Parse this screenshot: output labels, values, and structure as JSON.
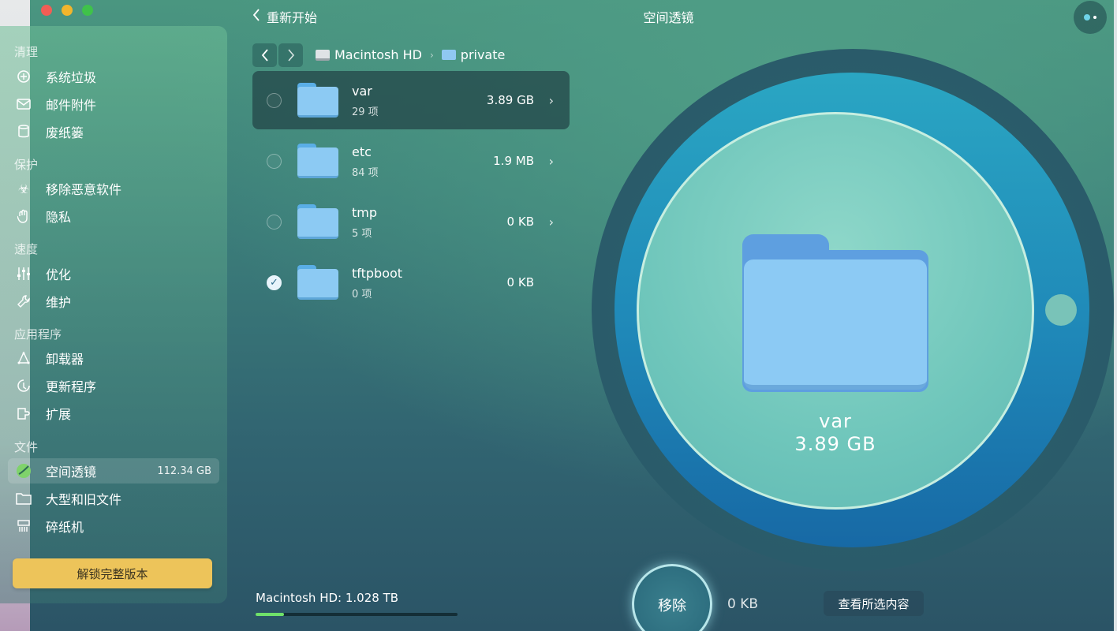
{
  "window": {
    "restart_label": "重新开始",
    "title": "空间透镜"
  },
  "sidebar": {
    "sections": [
      {
        "label": "清理",
        "items": [
          {
            "label": "系统垃圾",
            "icon": "trash-disc-icon"
          },
          {
            "label": "邮件附件",
            "icon": "envelope-icon"
          },
          {
            "label": "废纸篓",
            "icon": "bin-icon"
          }
        ]
      },
      {
        "label": "保护",
        "items": [
          {
            "label": "移除恶意软件",
            "icon": "biohazard-icon"
          },
          {
            "label": "隐私",
            "icon": "hand-icon"
          }
        ]
      },
      {
        "label": "速度",
        "items": [
          {
            "label": "优化",
            "icon": "sliders-icon"
          },
          {
            "label": "维护",
            "icon": "wrench-icon"
          }
        ]
      },
      {
        "label": "应用程序",
        "items": [
          {
            "label": "卸载器",
            "icon": "uninstaller-icon"
          },
          {
            "label": "更新程序",
            "icon": "update-icon"
          },
          {
            "label": "扩展",
            "icon": "extension-icon"
          }
        ]
      },
      {
        "label": "文件",
        "items": [
          {
            "label": "空间透镜",
            "icon": "space-lens-icon",
            "count": "112.34 GB",
            "active": true
          },
          {
            "label": "大型和旧文件",
            "icon": "folder-icon"
          },
          {
            "label": "碎纸机",
            "icon": "shredder-icon"
          }
        ]
      }
    ],
    "unlock_label": "解锁完整版本"
  },
  "breadcrumb": {
    "drive": "Macintosh HD",
    "folder": "private"
  },
  "files": [
    {
      "name": "var",
      "count": "29 项",
      "size": "3.89 GB",
      "selected": true,
      "checked": false,
      "chevron": true
    },
    {
      "name": "etc",
      "count": "84 项",
      "size": "1.9 MB",
      "selected": false,
      "checked": false,
      "chevron": true
    },
    {
      "name": "tmp",
      "count": "5 项",
      "size": "0 KB",
      "selected": false,
      "checked": false,
      "chevron": true
    },
    {
      "name": "tftpboot",
      "count": "0 项",
      "size": "0 KB",
      "selected": false,
      "checked": true,
      "chevron": false
    }
  ],
  "disk": {
    "label": "Macintosh HD: 1.028 TB",
    "used_fraction": 0.14,
    "fill_color": "#6fe06a"
  },
  "lens": {
    "name": "var",
    "size": "3.89 GB"
  },
  "actions": {
    "remove_label": "移除",
    "selected_size": "0 KB",
    "view_selected_label": "查看所选内容"
  },
  "colors": {
    "accent": "#edc45a",
    "lens_ring": "#1f88b8",
    "lens_inner": "#6fc6bb"
  }
}
